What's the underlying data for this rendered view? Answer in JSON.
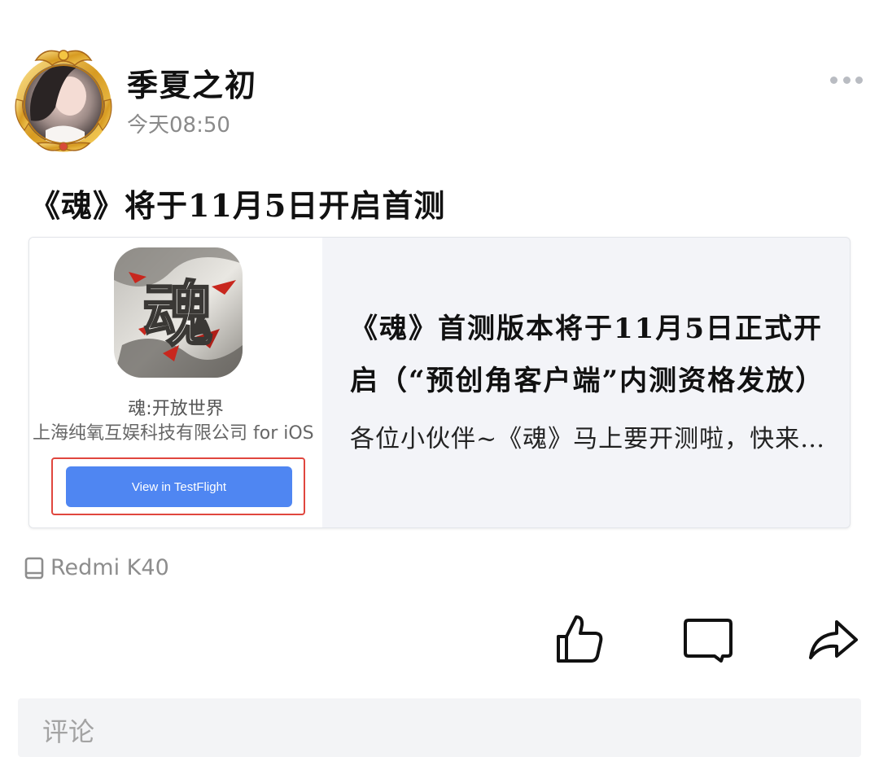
{
  "author": {
    "name": "季夏之初",
    "time": "今天08:50"
  },
  "post": {
    "title": "《魂》将于11月5日开启首测"
  },
  "card": {
    "app_icon_char": "魂",
    "app_name": "魂:开放世界",
    "developer": "上海纯氧互娱科技有限公司 for iOS",
    "testflight_label": "View in TestFlight",
    "headline": "《魂》首测版本将于11月5日正式开启（“预创角客户端”内测资格发放）",
    "description": "各位小伙伴~《魂》马上要开测啦，快来看看吧"
  },
  "device": {
    "label": "Redmi K40"
  },
  "comment": {
    "placeholder": "评论"
  },
  "colors": {
    "accent_button": "#4f86f2",
    "highlight_border": "#e0463e",
    "card_bg": "#f3f4f8",
    "muted_text": "#8a8a8a"
  },
  "icons": [
    "avatar-frame",
    "more-icon",
    "phone-icon",
    "thumbs-up-icon",
    "comment-icon",
    "share-icon"
  ]
}
